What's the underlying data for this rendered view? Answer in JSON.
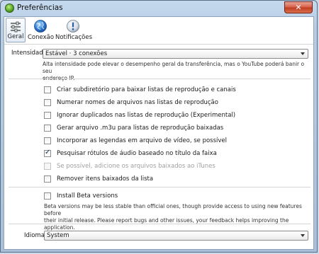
{
  "window": {
    "title": "Preferências",
    "close_glyph": "✕"
  },
  "toolbar": {
    "tabs": [
      {
        "label": "Geral",
        "icon": "sliders-icon",
        "active": true
      },
      {
        "label": "Conexão",
        "icon": "globe-icon",
        "active": false
      },
      {
        "label": "Notificações",
        "icon": "info-exclamation-icon",
        "active": false
      }
    ]
  },
  "intensity": {
    "label": "Intensidade",
    "value": "Estável · 3 conexões",
    "hint_line1": "Alta intensidade pode elevar o desempenho geral da transferência, mas o YouTube poderá banir o seu",
    "hint_line2": "endereço IP."
  },
  "options": [
    {
      "label": "Criar subdiretório para baixar listas de reprodução e canais",
      "checked": false,
      "disabled": false
    },
    {
      "label": "Numerar nomes de arquivos nas listas de reprodução",
      "checked": false,
      "disabled": false
    },
    {
      "label": "Ignorar duplicados nas listas de reprodução (Experimental)",
      "checked": false,
      "disabled": false
    },
    {
      "label": "Gerar arquivo .m3u para listas de reprodução baixadas",
      "checked": false,
      "disabled": false
    },
    {
      "label": "Incorporar as legendas em arquivo de vídeo, se possível",
      "checked": false,
      "disabled": false
    },
    {
      "label": "Pesquisar rótulos de áudio baseado no título da faixa",
      "checked": true,
      "disabled": false
    },
    {
      "label": "Se possível, adicione os arquivos baixados ao iTunes",
      "checked": false,
      "disabled": true
    },
    {
      "label": "Remover itens baixados da lista",
      "checked": false,
      "disabled": false
    }
  ],
  "beta": {
    "label": "Install Beta versions",
    "checked": false,
    "hint_line1": "Beta versions may be less stable than official ones, though provide access to using new features before",
    "hint_line2": "their initial release. Please report bugs and other issues, your feedback helps improving the application."
  },
  "language": {
    "label": "Idioma",
    "value": "System"
  }
}
